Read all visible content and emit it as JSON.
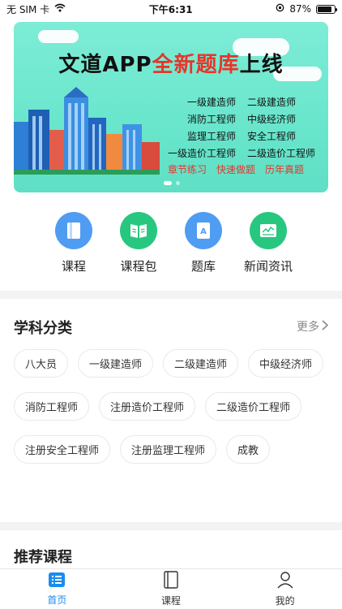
{
  "status_bar": {
    "carrier": "无 SIM 卡",
    "time": "下午6:31",
    "battery": "87%",
    "battery_level": 0.87
  },
  "banner": {
    "title_part1": "文道APP",
    "title_part2": "全新题库",
    "title_part3": "上线",
    "exams": [
      "一级建造师",
      "二级建造师",
      "消防工程师",
      "中级经济师",
      "监理工程师",
      "安全工程师",
      "一级造价工程师",
      "二级造价工程师"
    ],
    "highlights": [
      "章节练习",
      "快速做题",
      "历年真题"
    ],
    "colors": {
      "title_red": "#e8342a",
      "background": "#6ee8cf"
    }
  },
  "quick_nav": [
    {
      "label": "课程",
      "icon": "book-icon"
    },
    {
      "label": "课程包",
      "icon": "open-book-icon"
    },
    {
      "label": "题库",
      "icon": "question-bank-icon"
    },
    {
      "label": "新闻资讯",
      "icon": "news-icon"
    }
  ],
  "subjects": {
    "title": "学科分类",
    "more": "更多",
    "tags": [
      "八大员",
      "一级建造师",
      "二级建造师",
      "中级经济师",
      "消防工程师",
      "注册造价工程师",
      "二级造价工程师",
      "注册安全工程师",
      "注册监理工程师",
      "成教"
    ]
  },
  "recommended": {
    "title": "推荐课程"
  },
  "tab_bar": [
    {
      "label": "首页",
      "icon": "home-list-icon",
      "active": true
    },
    {
      "label": "课程",
      "icon": "book-icon",
      "active": false
    },
    {
      "label": "我的",
      "icon": "person-icon",
      "active": false
    }
  ],
  "colors": {
    "accent": "#1a8cf0",
    "blue_icon": "#4f9cf3",
    "green_icon": "#28c77f"
  }
}
